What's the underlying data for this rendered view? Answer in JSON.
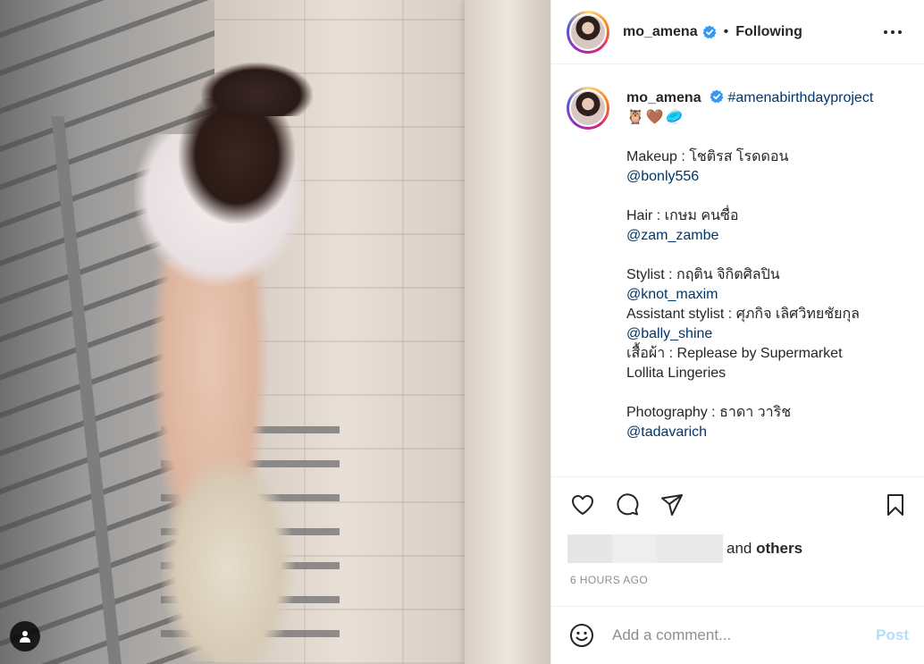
{
  "post": {
    "username": "mo_amena",
    "follow_separator": "•",
    "follow_status": "Following",
    "caption": {
      "hashtag": "#amenabirthdayproject",
      "emojis": "🦉🤎🥏",
      "makeup_label": "Makeup : โชติรส โรดดอน",
      "makeup_handle": "@bonly556",
      "hair_label": "Hair : เกษม คนซื่อ",
      "hair_handle": "@zam_zambe",
      "stylist_label": "Stylist : กฤติน จิกิตศิลปิน",
      "stylist_handle": "@knot_maxim",
      "assistant_label": "Assistant stylist : ศุภกิจ เลิศวิทยชัยกุล",
      "assistant_handle": "@bally_shine",
      "clothes_line1": "เสื้อผ้า : Replease by Supermarket",
      "clothes_line2": "Lollita Lingeries",
      "photo_label": "Photography : ธาดา วาริช",
      "photo_handle": "@tadavarich"
    },
    "likes": {
      "and_text": "and",
      "others_text": "others"
    },
    "timestamp": "6 HOURS AGO",
    "comment": {
      "placeholder": "Add a comment...",
      "post_label": "Post"
    }
  },
  "icons": {
    "more": "more-options-icon",
    "like": "heart-icon",
    "comment": "comment-icon",
    "share": "share-icon",
    "save": "bookmark-icon",
    "emoji": "emoji-icon",
    "tag": "user-tag-icon"
  },
  "colors": {
    "link": "#00376b",
    "verified": "#3897f0",
    "muted": "#8e8e8e",
    "post_button": "#b2dffc"
  }
}
